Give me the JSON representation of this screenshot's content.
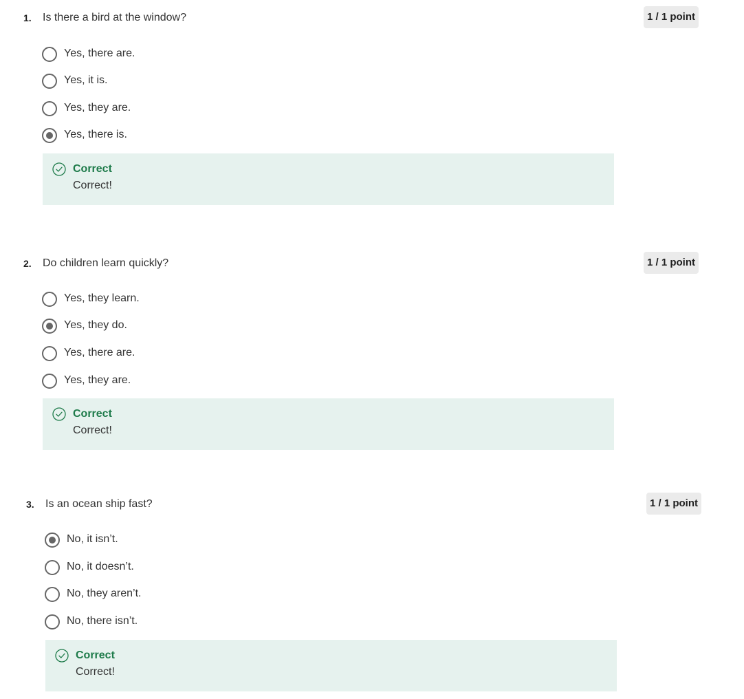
{
  "questions": [
    {
      "number": "1.",
      "text": "Is there a bird at the window?",
      "points": "1 / 1 point",
      "options": [
        {
          "label": "Yes, there are.",
          "selected": false
        },
        {
          "label": "Yes, it is.",
          "selected": false
        },
        {
          "label": "Yes, they are.",
          "selected": false
        },
        {
          "label": "Yes, there is.",
          "selected": true
        }
      ],
      "feedback": {
        "title": "Correct",
        "text": "Correct!",
        "icon": "check-circle-icon",
        "color": "#1e7b4a",
        "background": "#e6f2ee"
      }
    },
    {
      "number": "2.",
      "text": "Do children learn quickly?",
      "points": "1 / 1 point",
      "options": [
        {
          "label": "Yes, they learn.",
          "selected": false
        },
        {
          "label": "Yes, they do.",
          "selected": true
        },
        {
          "label": "Yes, there are.",
          "selected": false
        },
        {
          "label": "Yes, they are.",
          "selected": false
        }
      ],
      "feedback": {
        "title": "Correct",
        "text": "Correct!",
        "icon": "check-circle-icon",
        "color": "#1e7b4a",
        "background": "#e6f2ee"
      }
    },
    {
      "number": "3.",
      "text": "Is an ocean ship fast?",
      "points": "1 / 1 point",
      "options": [
        {
          "label": "No, it isn’t.",
          "selected": true
        },
        {
          "label": "No, it doesn’t.",
          "selected": false
        },
        {
          "label": "No, they aren’t.",
          "selected": false
        },
        {
          "label": "No, there isn’t.",
          "selected": false
        }
      ],
      "feedback": {
        "title": "Correct",
        "text": "Correct!",
        "icon": "check-circle-icon",
        "color": "#1e7b4a",
        "background": "#e6f2ee"
      }
    }
  ]
}
